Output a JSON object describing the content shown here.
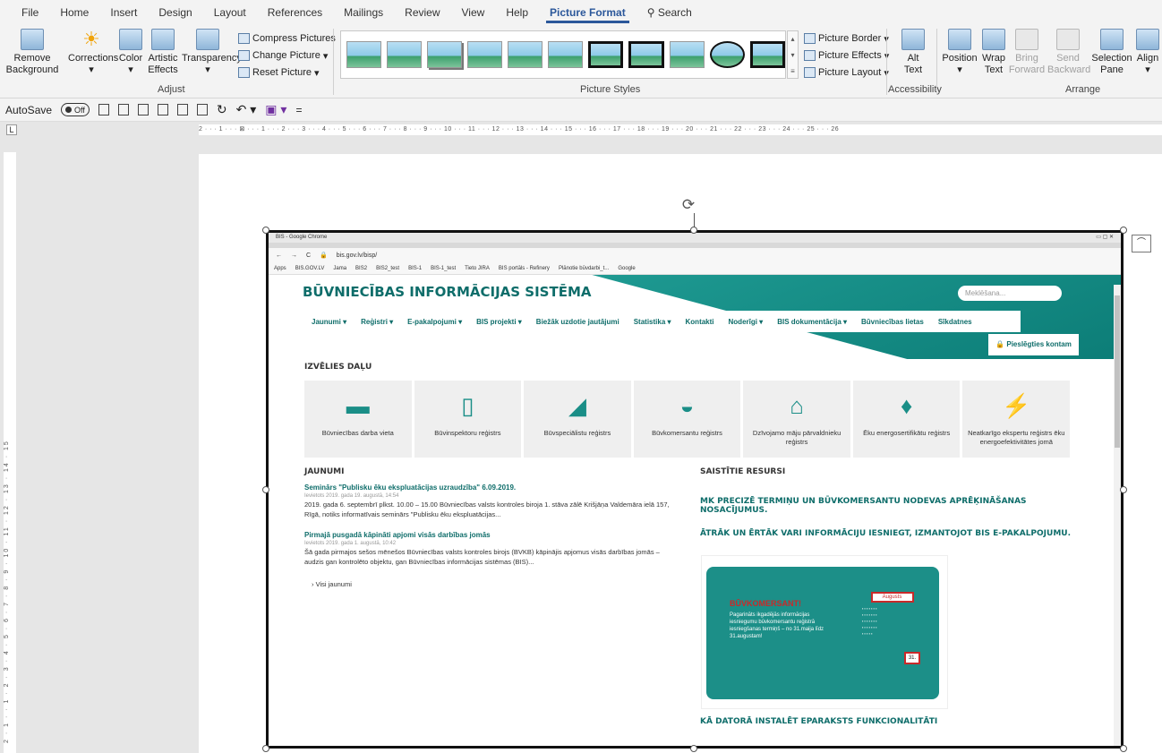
{
  "menu": {
    "items": [
      "File",
      "Home",
      "Insert",
      "Design",
      "Layout",
      "References",
      "Mailings",
      "Review",
      "View",
      "Help",
      "Picture Format"
    ],
    "search": "Search"
  },
  "ribbon": {
    "remove_bg": "Remove\nBackground",
    "remove_bg_1": "Remove",
    "remove_bg_2": "Background",
    "corrections": "Corrections",
    "color": "Color",
    "artistic_1": "Artistic",
    "artistic_2": "Effects",
    "transparency": "Transparency",
    "compress": "Compress Pictures",
    "change": "Change Picture",
    "reset": "Reset Picture",
    "adjust_label": "Adjust",
    "styles_label": "Picture Styles",
    "border": "Picture Border",
    "effects": "Picture Effects",
    "layout": "Picture Layout",
    "alt_1": "Alt",
    "alt_2": "Text",
    "accessibility_label": "Accessibility",
    "position": "Position",
    "wrap_1": "Wrap",
    "wrap_2": "Text",
    "bring_1": "Bring",
    "bring_2": "Forward",
    "send_1": "Send",
    "send_2": "Backward",
    "selection_1": "Selection",
    "selection_2": "Pane",
    "align": "Align",
    "arrange_label": "Arrange"
  },
  "qat": {
    "autosave": "AutoSave",
    "toggle": "Off"
  },
  "ruler": {
    "top": "2 · · · 1 · · · ⊠ · · · 1 · · · 2 · · · 3 · · · 4 · · · 5 · · · 6 · · · 7 · · · 8 · · · 9 · · · 10 · · · 11 · · · 12 · · · 13 · · · 14 · · · 15 · · · 16 · · · 17 · · · 18 · · · 19 · · · 20 · · · 21 · · · 22 · · · 23 · · · 24 · · · 25 · · · 26",
    "left": "2 · 1 · · 1 · 2 · 3 · 4 · 5 · 6 · 7 · 8 · 9 · 10 · 11 · 12 · 13 · 14 · 15"
  },
  "browser": {
    "title": "BIS - Google Chrome",
    "url": "bis.gov.lv/bisp/",
    "bookmarks": [
      "Apps",
      "BIS.GOV.LV",
      "Jama",
      "BIS2",
      "BIS2_test",
      "BIS-1",
      "BIS-1_test",
      "Tieto JIRA",
      "BIS portāls - Refinery",
      "Plānotie būvdarbi_t...",
      "Google"
    ]
  },
  "site": {
    "title": "BŪVNIECĪBAS INFORMĀCIJAS SISTĒMA",
    "search_placeholder": "Meklēšana...",
    "nav": [
      "Jaunumi ▾",
      "Reģistri ▾",
      "E-pakalpojumi ▾",
      "BIS projekti ▾",
      "Biežāk uzdotie jautājumi",
      "Statistika ▾",
      "Kontakti",
      "Noderīgi ▾",
      "BIS dokumentācija ▾",
      "Būvniecības lietas",
      "Sīkdatnes"
    ],
    "login": "🔒 Pieslēgties kontam",
    "choose_heading": "IZVĒLIES DAĻU",
    "cards": [
      "Būvniecības darba vieta",
      "Būvinspektoru reģistrs",
      "Būvspeciālistu reģistrs",
      "Būvkomersantu reģistrs",
      "Dzīvojamo māju pārvaldnieku reģistrs",
      "Ēku energosertifikātu reģistrs",
      "Neatkarīgo ekspertu reģistrs ēku energoefektivitātes jomā"
    ],
    "news_heading": "JAUNUMI",
    "news": [
      {
        "title": "Seminārs \"Publisku ēku ekspluatācijas uzraudzība\" 6.09.2019.",
        "date": "Ievietots 2019. gada 19. augustā, 14:54",
        "text": "2019. gada 6. septembrī plkst. 10.00 – 15.00 Būvniecības valsts kontroles biroja 1. stāva zālē Krišjāņa Valdemāra ielā 157, Rīgā, notiks informatīvais seminārs \"Publisku ēku ekspluatācijas..."
      },
      {
        "title": "Pirmajā pusgadā kāpināti apjomi visās darbības jomās",
        "date": "Ievietots 2019. gada 1. augustā, 10:42",
        "text": "Šā gada pirmajos sešos mēnešos Būvniecības valsts kontroles birojs (BVKB) kāpinājis apjomus visās darbības jomās – audzis gan kontrolēto objektu, gan Būvniecības informācijas sistēmas (BIS)..."
      }
    ],
    "all_news": "›  Visi jaunumi",
    "resources_heading": "SAISTĪTIE RESURSI",
    "resources": [
      "MK PRECIZĒ TERMIŅU UN BŪVKOMERSANTU NODEVAS APRĒĶINĀŠANAS NOSACĪJUMUS.",
      "ĀTRĀK UN ĒRTĀK VARI INFORMĀCIJU IESNIEGT, IZMANTOJOT BIS E-PAKALPOJUMU."
    ],
    "banner_title": "BŪVKOMERSANT!",
    "banner_text": "Pagarināts ikgadējās informācijas iesniegumu būvkomersantu reģistrā iesniegšanas termiņš – no 31.maija līdz 31.augustam!",
    "banner_month": "Augusts",
    "banner_day": "31.",
    "eparaksts": "KĀ DATORĀ INSTALĒT EPARAKSTS FUNKCIONALITĀTI"
  },
  "colors": {
    "accent": "#2b579a",
    "teal": "#0e6d6a"
  }
}
